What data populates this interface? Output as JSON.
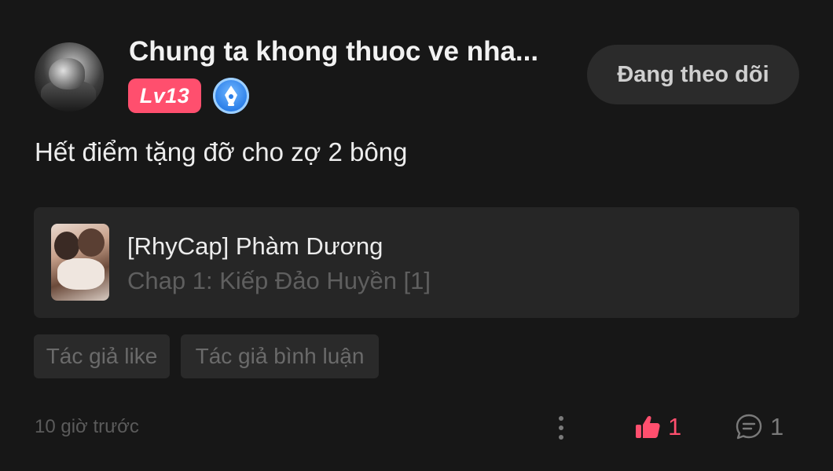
{
  "post": {
    "author": {
      "name": "Chung ta khong thuoc ve nha...",
      "level": "Lv13",
      "badge_icon": "pen-nib-icon"
    },
    "follow_label": "Đang theo dõi",
    "text": "Hết điểm tặng đỡ cho zợ 2 bông",
    "story": {
      "title": "[RhyCap] Phàm Dương",
      "chapter": "Chap 1: Kiếp Đảo Huyền [1]"
    },
    "tags": [
      "Tác giả like",
      "Tác giả bình luận"
    ],
    "timestamp": "10 giờ trước",
    "likes": "1",
    "comments": "1"
  },
  "colors": {
    "background": "#171717",
    "accent": "#ff4f6e",
    "card": "#262626",
    "muted_text": "#5f5f5f"
  }
}
